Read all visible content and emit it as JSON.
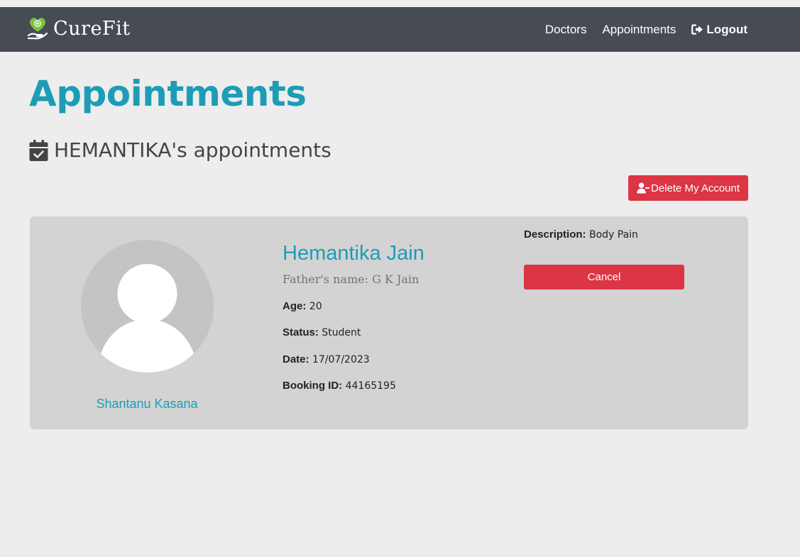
{
  "navbar": {
    "brand": "CureFit",
    "links": [
      {
        "label": "Doctors"
      },
      {
        "label": "Appointments"
      },
      {
        "label": "Logout",
        "icon": "logout-icon"
      }
    ]
  },
  "page": {
    "title": "Appointments",
    "subtitle": "HEMANTIKA's appointments",
    "subtitle_icon": "calendar-check-icon",
    "delete_button": "Delete My Account",
    "delete_icon": "user-minus-icon"
  },
  "appointment": {
    "doctor_name": "Shantanu Kasana",
    "patient_name": "Hemantika Jain",
    "father_name": "Father's name: G K Jain",
    "age_label": "Age:",
    "age": "20",
    "status_label": "Status:",
    "status": "Student",
    "date_label": "Date:",
    "date": "17/07/2023",
    "booking_label": "Booking ID:",
    "booking_id": "44165195",
    "description_label": "Description:",
    "description": "Body Pain",
    "cancel_label": "Cancel"
  },
  "colors": {
    "navbar": "#474b53",
    "accent": "#1d9db5",
    "danger": "#dc3545",
    "background": "#ededed",
    "card": "#d3d3d3"
  }
}
